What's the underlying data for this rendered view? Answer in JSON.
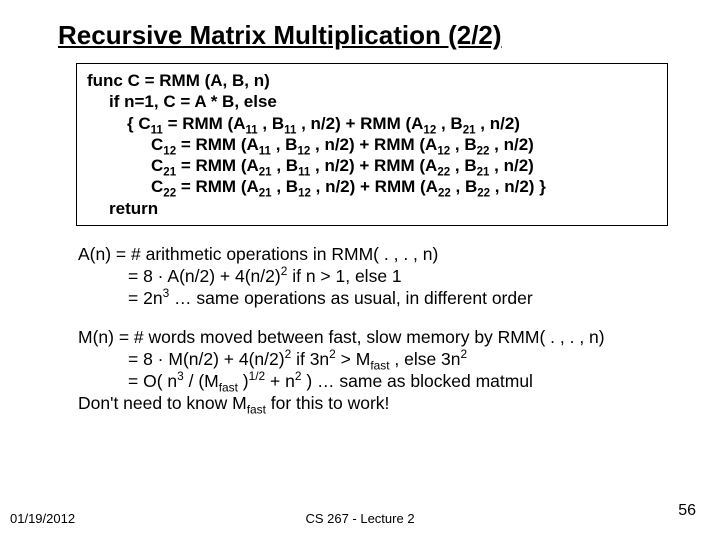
{
  "title": "Recursive Matrix Multiplication (2/2)",
  "code": {
    "l1": "func C = RMM (A, B, n)",
    "l2": "if n=1, C = A * B, else",
    "l3a": "{  C",
    "l3b": " = RMM (A",
    "l3c": " , B",
    "l3d": " , n/2) + RMM (A",
    "l3e": " , B",
    "l3f": " , n/2)",
    "l4a": "C",
    "l4b": " = RMM (A",
    "l4c": " , B",
    "l4d": " , n/2) + RMM (A",
    "l4e": " , B",
    "l4f": " , n/2)",
    "l5f": " , n/2)",
    "l6f": " , n/2)  }",
    "ret": "return"
  },
  "s": {
    "s11": "11",
    "s12": "12",
    "s21": "21",
    "s22": "22"
  },
  "A": {
    "l1": "A(n)  = # arithmetic operations in RMM( . , . , n)",
    "l2a": "= 8 · A(n/2) + 4(n/2)",
    "l2b": "  if  n > 1,   else 1",
    "l3a": "= 2n",
    "l3b": "   …  same operations as usual, in different order",
    "exp2": "2",
    "exp3": "3"
  },
  "M": {
    "l1": "M(n) = # words moved between fast, slow memory by RMM( . , . , n)",
    "l2a": "= 8 · M(n/2) + 4(n/2)",
    "l2b": "  if  3n",
    "l2c": " > M",
    "l2d": " ,  else 3n",
    "l3a": "= O( n",
    "l3b": " / (M",
    "l3c": " )",
    "l3d": " + n",
    "l3e": " )   … same as blocked matmul",
    "l4a": "Don't need to know M",
    "l4b": " for this to work!",
    "sub_fast": "fast",
    "exp2": "2",
    "exp3": "3",
    "exp12": "1/2"
  },
  "footer": {
    "date": "01/19/2012",
    "course": "CS 267 - Lecture 2",
    "page": "56"
  }
}
